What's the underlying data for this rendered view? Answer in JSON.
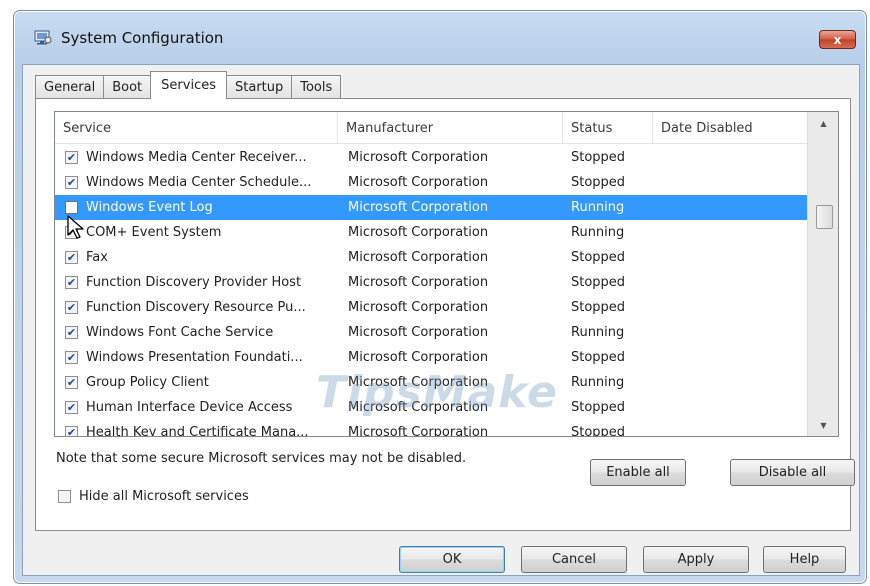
{
  "window": {
    "title": "System Configuration",
    "close_label": "x"
  },
  "tabs": [
    "General",
    "Boot",
    "Services",
    "Startup",
    "Tools"
  ],
  "active_tab": "Services",
  "columns": [
    "Service",
    "Manufacturer",
    "Status",
    "Date Disabled"
  ],
  "services": [
    {
      "checked": true,
      "name": "Windows Media Center Receiver...",
      "manufacturer": "Microsoft Corporation",
      "status": "Stopped",
      "date": ""
    },
    {
      "checked": true,
      "name": "Windows Media Center Schedule...",
      "manufacturer": "Microsoft Corporation",
      "status": "Stopped",
      "date": ""
    },
    {
      "checked": false,
      "name": "Windows Event Log",
      "manufacturer": "Microsoft Corporation",
      "status": "Running",
      "date": "",
      "selected": true
    },
    {
      "checked": true,
      "name": "COM+ Event System",
      "manufacturer": "Microsoft Corporation",
      "status": "Running",
      "date": ""
    },
    {
      "checked": true,
      "name": "Fax",
      "manufacturer": "Microsoft Corporation",
      "status": "Stopped",
      "date": ""
    },
    {
      "checked": true,
      "name": "Function Discovery Provider Host",
      "manufacturer": "Microsoft Corporation",
      "status": "Stopped",
      "date": ""
    },
    {
      "checked": true,
      "name": "Function Discovery Resource Pu...",
      "manufacturer": "Microsoft Corporation",
      "status": "Stopped",
      "date": ""
    },
    {
      "checked": true,
      "name": "Windows Font Cache Service",
      "manufacturer": "Microsoft Corporation",
      "status": "Running",
      "date": ""
    },
    {
      "checked": true,
      "name": "Windows Presentation Foundati...",
      "manufacturer": "Microsoft Corporation",
      "status": "Stopped",
      "date": ""
    },
    {
      "checked": true,
      "name": "Group Policy Client",
      "manufacturer": "Microsoft Corporation",
      "status": "Running",
      "date": ""
    },
    {
      "checked": true,
      "name": "Human Interface Device Access",
      "manufacturer": "Microsoft Corporation",
      "status": "Stopped",
      "date": ""
    },
    {
      "checked": true,
      "name": "Health Key and Certificate Mana...",
      "manufacturer": "Microsoft Corporation",
      "status": "Stopped",
      "date": ""
    }
  ],
  "note": "Note that some secure Microsoft services may not be disabled.",
  "buttons": {
    "enable_all": "Enable all",
    "disable_all": "Disable all",
    "ok": "OK",
    "cancel": "Cancel",
    "apply": "Apply",
    "help": "Help"
  },
  "hide_ms": {
    "label": "Hide all Microsoft services",
    "checked": false
  },
  "watermark": "TipsMake",
  "colors": {
    "selection": "#3399ff",
    "close_button": "#c9452e",
    "titlebar": "#b8cfe9"
  },
  "icons": {
    "app": "system-config-icon",
    "check": "checkmark-icon",
    "cursor": "mouse-pointer-icon"
  }
}
